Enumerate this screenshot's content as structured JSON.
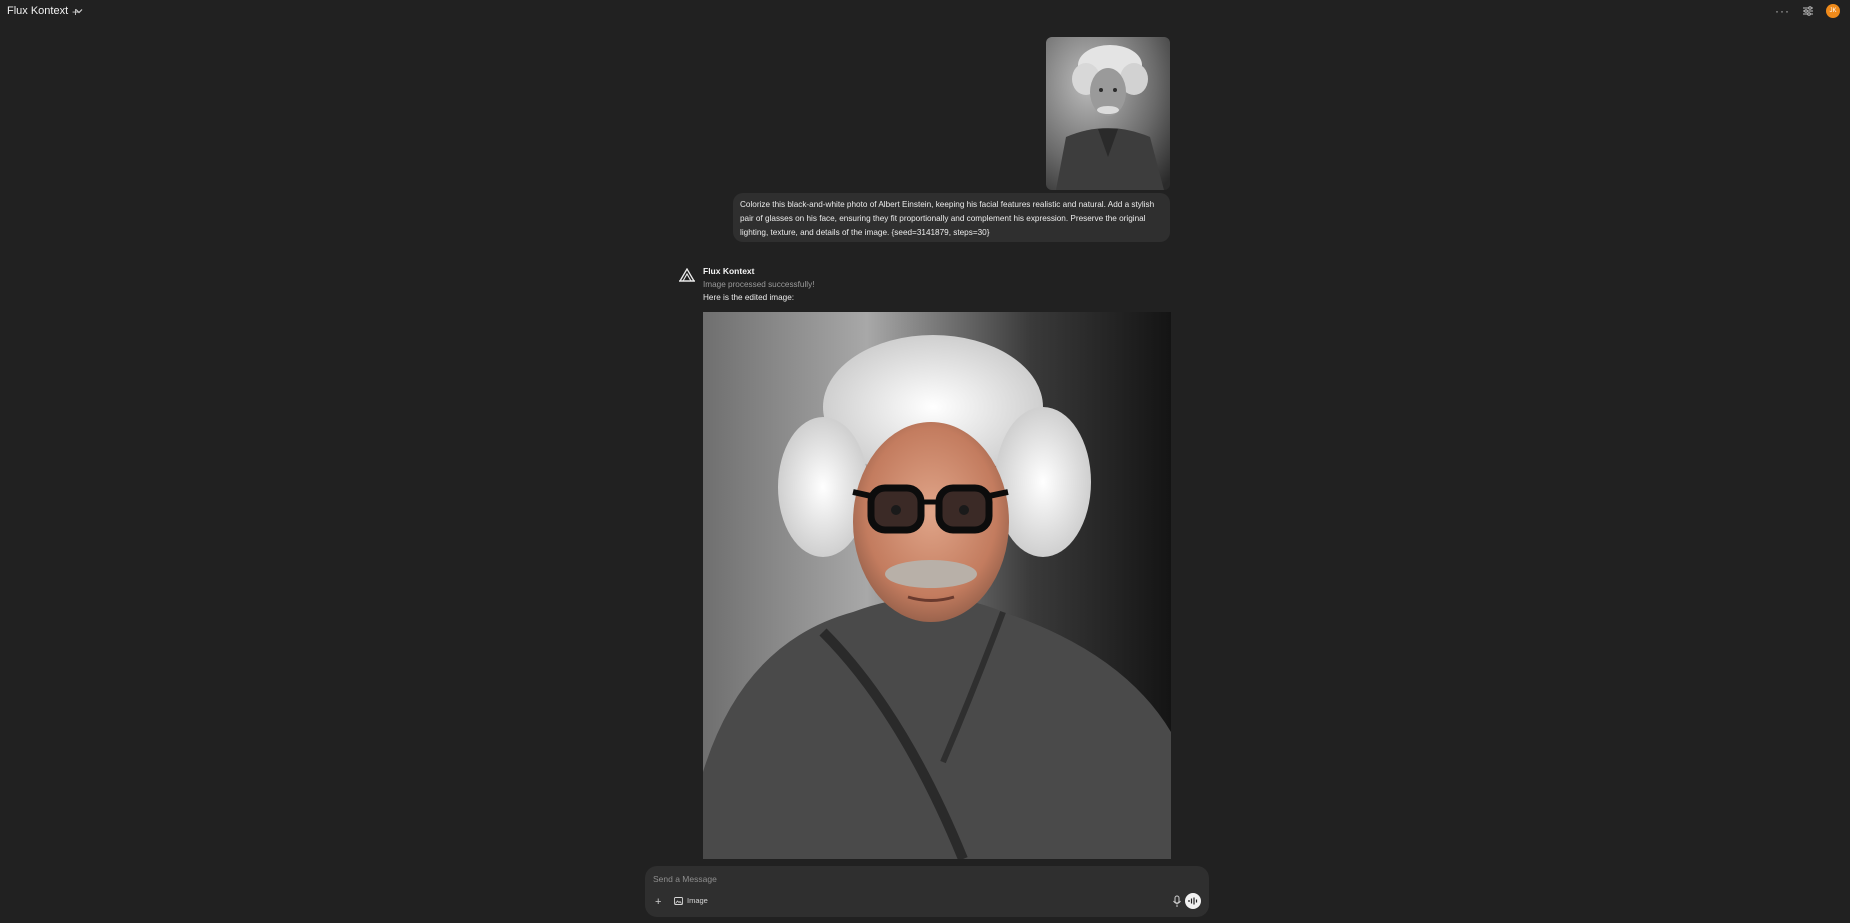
{
  "header": {
    "model_name": "Flux Kontext",
    "new_chat_icon": "plus-icon",
    "menu_icon": "more-horizontal-icon",
    "controls_icon": "sliders-icon",
    "avatar_initials": "JK",
    "avatar_color": "#ef8a1a"
  },
  "conversation": {
    "user_message": {
      "image_alt": "black-and-white portrait",
      "text": "Colorize this black-and-white photo of Albert Einstein, keeping his facial features realistic and natural. Add a stylish pair of glasses on his face, ensuring they fit proportionally and complement his expression. Preserve the original lighting, texture, and details of the image. {seed=3141879, steps=30}"
    },
    "assistant_message": {
      "name": "Flux Kontext",
      "status": "Image processed successfully!",
      "text": "Here is the edited image:",
      "image_alt": "edited colorized portrait"
    }
  },
  "composer": {
    "placeholder": "Send a Message",
    "image_toggle_label": "Image",
    "accent": "#f2f2f2"
  }
}
